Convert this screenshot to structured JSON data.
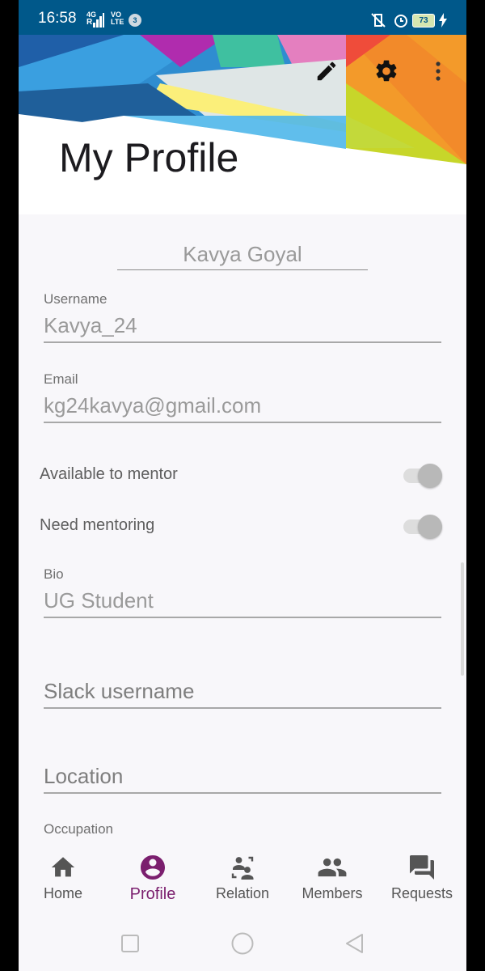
{
  "status_bar": {
    "time": "16:58",
    "net_top": "4G",
    "net_r": "R",
    "volte_top": "VO",
    "volte_bottom": "LTE",
    "notif_count": "3",
    "battery": "73"
  },
  "header": {
    "title": "My Profile"
  },
  "profile": {
    "name": "Kavya Goyal",
    "username_label": "Username",
    "username": "Kavya_24",
    "email_label": "Email",
    "email": "kg24kavya@gmail.com",
    "available_label": "Available to mentor",
    "need_label": "Need mentoring",
    "bio_label": "Bio",
    "bio": "UG Student",
    "slack_placeholder": "Slack username",
    "location_placeholder": "Location",
    "occupation_label": "Occupation"
  },
  "nav": {
    "items": [
      {
        "label": "Home",
        "icon": "home-icon"
      },
      {
        "label": "Profile",
        "icon": "account-circle-icon"
      },
      {
        "label": "Relation",
        "icon": "relation-icon"
      },
      {
        "label": "Members",
        "icon": "people-icon"
      },
      {
        "label": "Requests",
        "icon": "chat-icon"
      }
    ],
    "active": "Profile"
  },
  "colors": {
    "status_bar": "#00588a",
    "accent": "#7b1f6e",
    "background": "#f8f7fa"
  }
}
